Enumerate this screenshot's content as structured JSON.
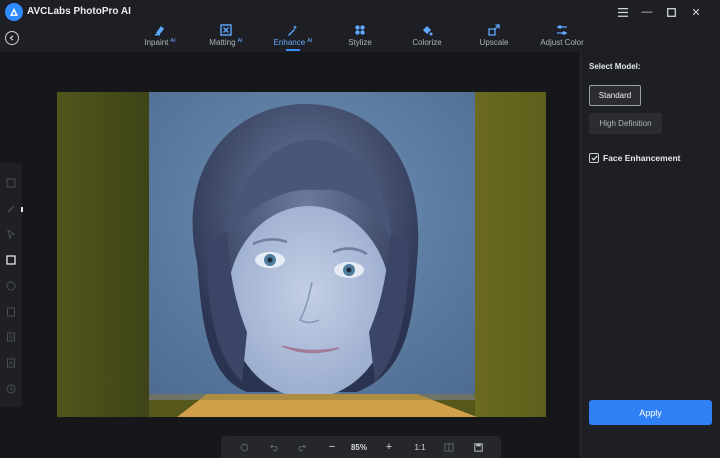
{
  "app": {
    "title": "AVCLabs PhotoPro AI"
  },
  "window": {
    "minimize_glyph": "—",
    "maximize_glyph": "☐",
    "close_glyph": "✕",
    "menu_icon": "menu-icon"
  },
  "tabs": [
    {
      "label": "Inpaint",
      "ai": "AI",
      "icon": "inpaint-icon",
      "active": false
    },
    {
      "label": "Matting",
      "ai": "AI",
      "icon": "matting-icon",
      "active": false
    },
    {
      "label": "Enhance",
      "ai": "AI",
      "icon": "enhance-icon",
      "active": true
    },
    {
      "label": "Stylize",
      "ai": "",
      "icon": "stylize-icon",
      "active": false
    },
    {
      "label": "Colorize",
      "ai": "",
      "icon": "colorize-icon",
      "active": false
    },
    {
      "label": "Upscale",
      "ai": "",
      "icon": "upscale-icon",
      "active": false
    },
    {
      "label": "Adjust Color",
      "ai": "",
      "icon": "adjust-color-icon",
      "active": false
    }
  ],
  "toolbar": {
    "tools": [
      "crop-icon",
      "brush-icon",
      "select-icon",
      "rect-select-icon",
      "lasso-icon",
      "copy-icon",
      "paste-icon",
      "layer-icon",
      "history-icon"
    ],
    "active_tool": "rect-select-icon"
  },
  "zoombar": {
    "zoom": "85%",
    "one_to_one": "1:1",
    "minus": "−",
    "plus": "+"
  },
  "panel": {
    "select_model_label": "Select Model:",
    "models": [
      "Standard",
      "High Definition"
    ],
    "selected_model": "Standard",
    "face_enhancement_label": "Face Enhancement",
    "face_enhancement_checked": true,
    "apply_label": "Apply"
  },
  "colors": {
    "accent": "#2f7ff5",
    "active_tab": "#6aa9ff",
    "background": "#1b1d22"
  }
}
